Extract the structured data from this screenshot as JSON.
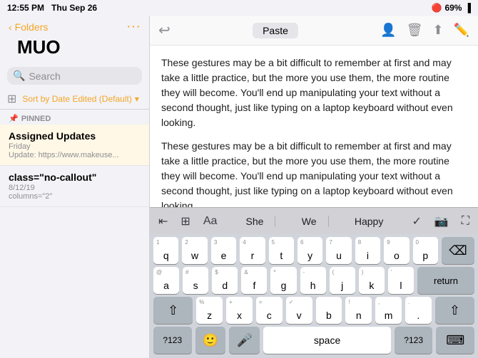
{
  "statusBar": {
    "time": "12:55 PM",
    "day": "Thu Sep 26",
    "battery": "69%",
    "batteryIcon": "🔴"
  },
  "sidebar": {
    "backLabel": "Folders",
    "title": "MUO",
    "searchPlaceholder": "Search",
    "sortLabel": "Sort by Date Edited (Default)",
    "pinnedLabel": "PINNED",
    "notes": [
      {
        "title": "Assigned Updates",
        "meta": "Friday",
        "preview": "Update: https://www.makeuse..."
      },
      {
        "title": "class=\"no-callout\"",
        "meta": "8/12/19",
        "preview": "columns=\"2\""
      }
    ]
  },
  "editor": {
    "pasteLabel": "Paste",
    "content": [
      "These gestures may be a bit difficult to remember at first and may take a little practice, but the more you use them, the more routine they will become. You'll end up manipulating your text without a second thought, just like typing on a laptop keyboard without even looking.",
      "These gestures may be a bit difficult to remember at first and may take a little practice, but the more you use them, the more routine they will become. You'll end up manipulating your text without a second thought, just like typing on a laptop keyboard without even looking."
    ]
  },
  "keyboardFormatBar": {
    "suggestions": [
      "She",
      "We",
      "Happy"
    ]
  },
  "keyboard": {
    "row1": [
      {
        "num": "1",
        "key": "q"
      },
      {
        "num": "2",
        "key": "w"
      },
      {
        "num": "3",
        "key": "e"
      },
      {
        "num": "4",
        "key": "r"
      },
      {
        "num": "5",
        "key": "t"
      },
      {
        "num": "6",
        "key": "y"
      },
      {
        "num": "7",
        "key": "u"
      },
      {
        "num": "8",
        "key": "i"
      },
      {
        "num": "9",
        "key": "o"
      },
      {
        "num": "0",
        "key": "p"
      }
    ],
    "row2": [
      {
        "num": "@",
        "key": "a"
      },
      {
        "num": "#",
        "key": "s"
      },
      {
        "num": "$",
        "key": "d"
      },
      {
        "num": "&",
        "key": "f"
      },
      {
        "num": "*",
        "key": "g"
      },
      {
        "num": "-",
        "key": "h"
      },
      {
        "num": "(",
        "key": "j"
      },
      {
        "num": ")",
        "key": "k"
      },
      {
        "num": "'",
        "key": "l"
      }
    ],
    "row3": [
      {
        "num": "%",
        "key": "z"
      },
      {
        "num": "+",
        "key": "x"
      },
      {
        "num": "=",
        "key": "c"
      },
      {
        "num": "✓",
        "key": "v"
      },
      {
        "num": "",
        "key": "b"
      },
      {
        "num": "!",
        "key": "n"
      },
      {
        "num": ",",
        "key": "m"
      }
    ],
    "spaceLabel": "space",
    "returnLabel": "return",
    "numSwitchLabel": "?123",
    "numSwitchLabel2": "?123"
  }
}
